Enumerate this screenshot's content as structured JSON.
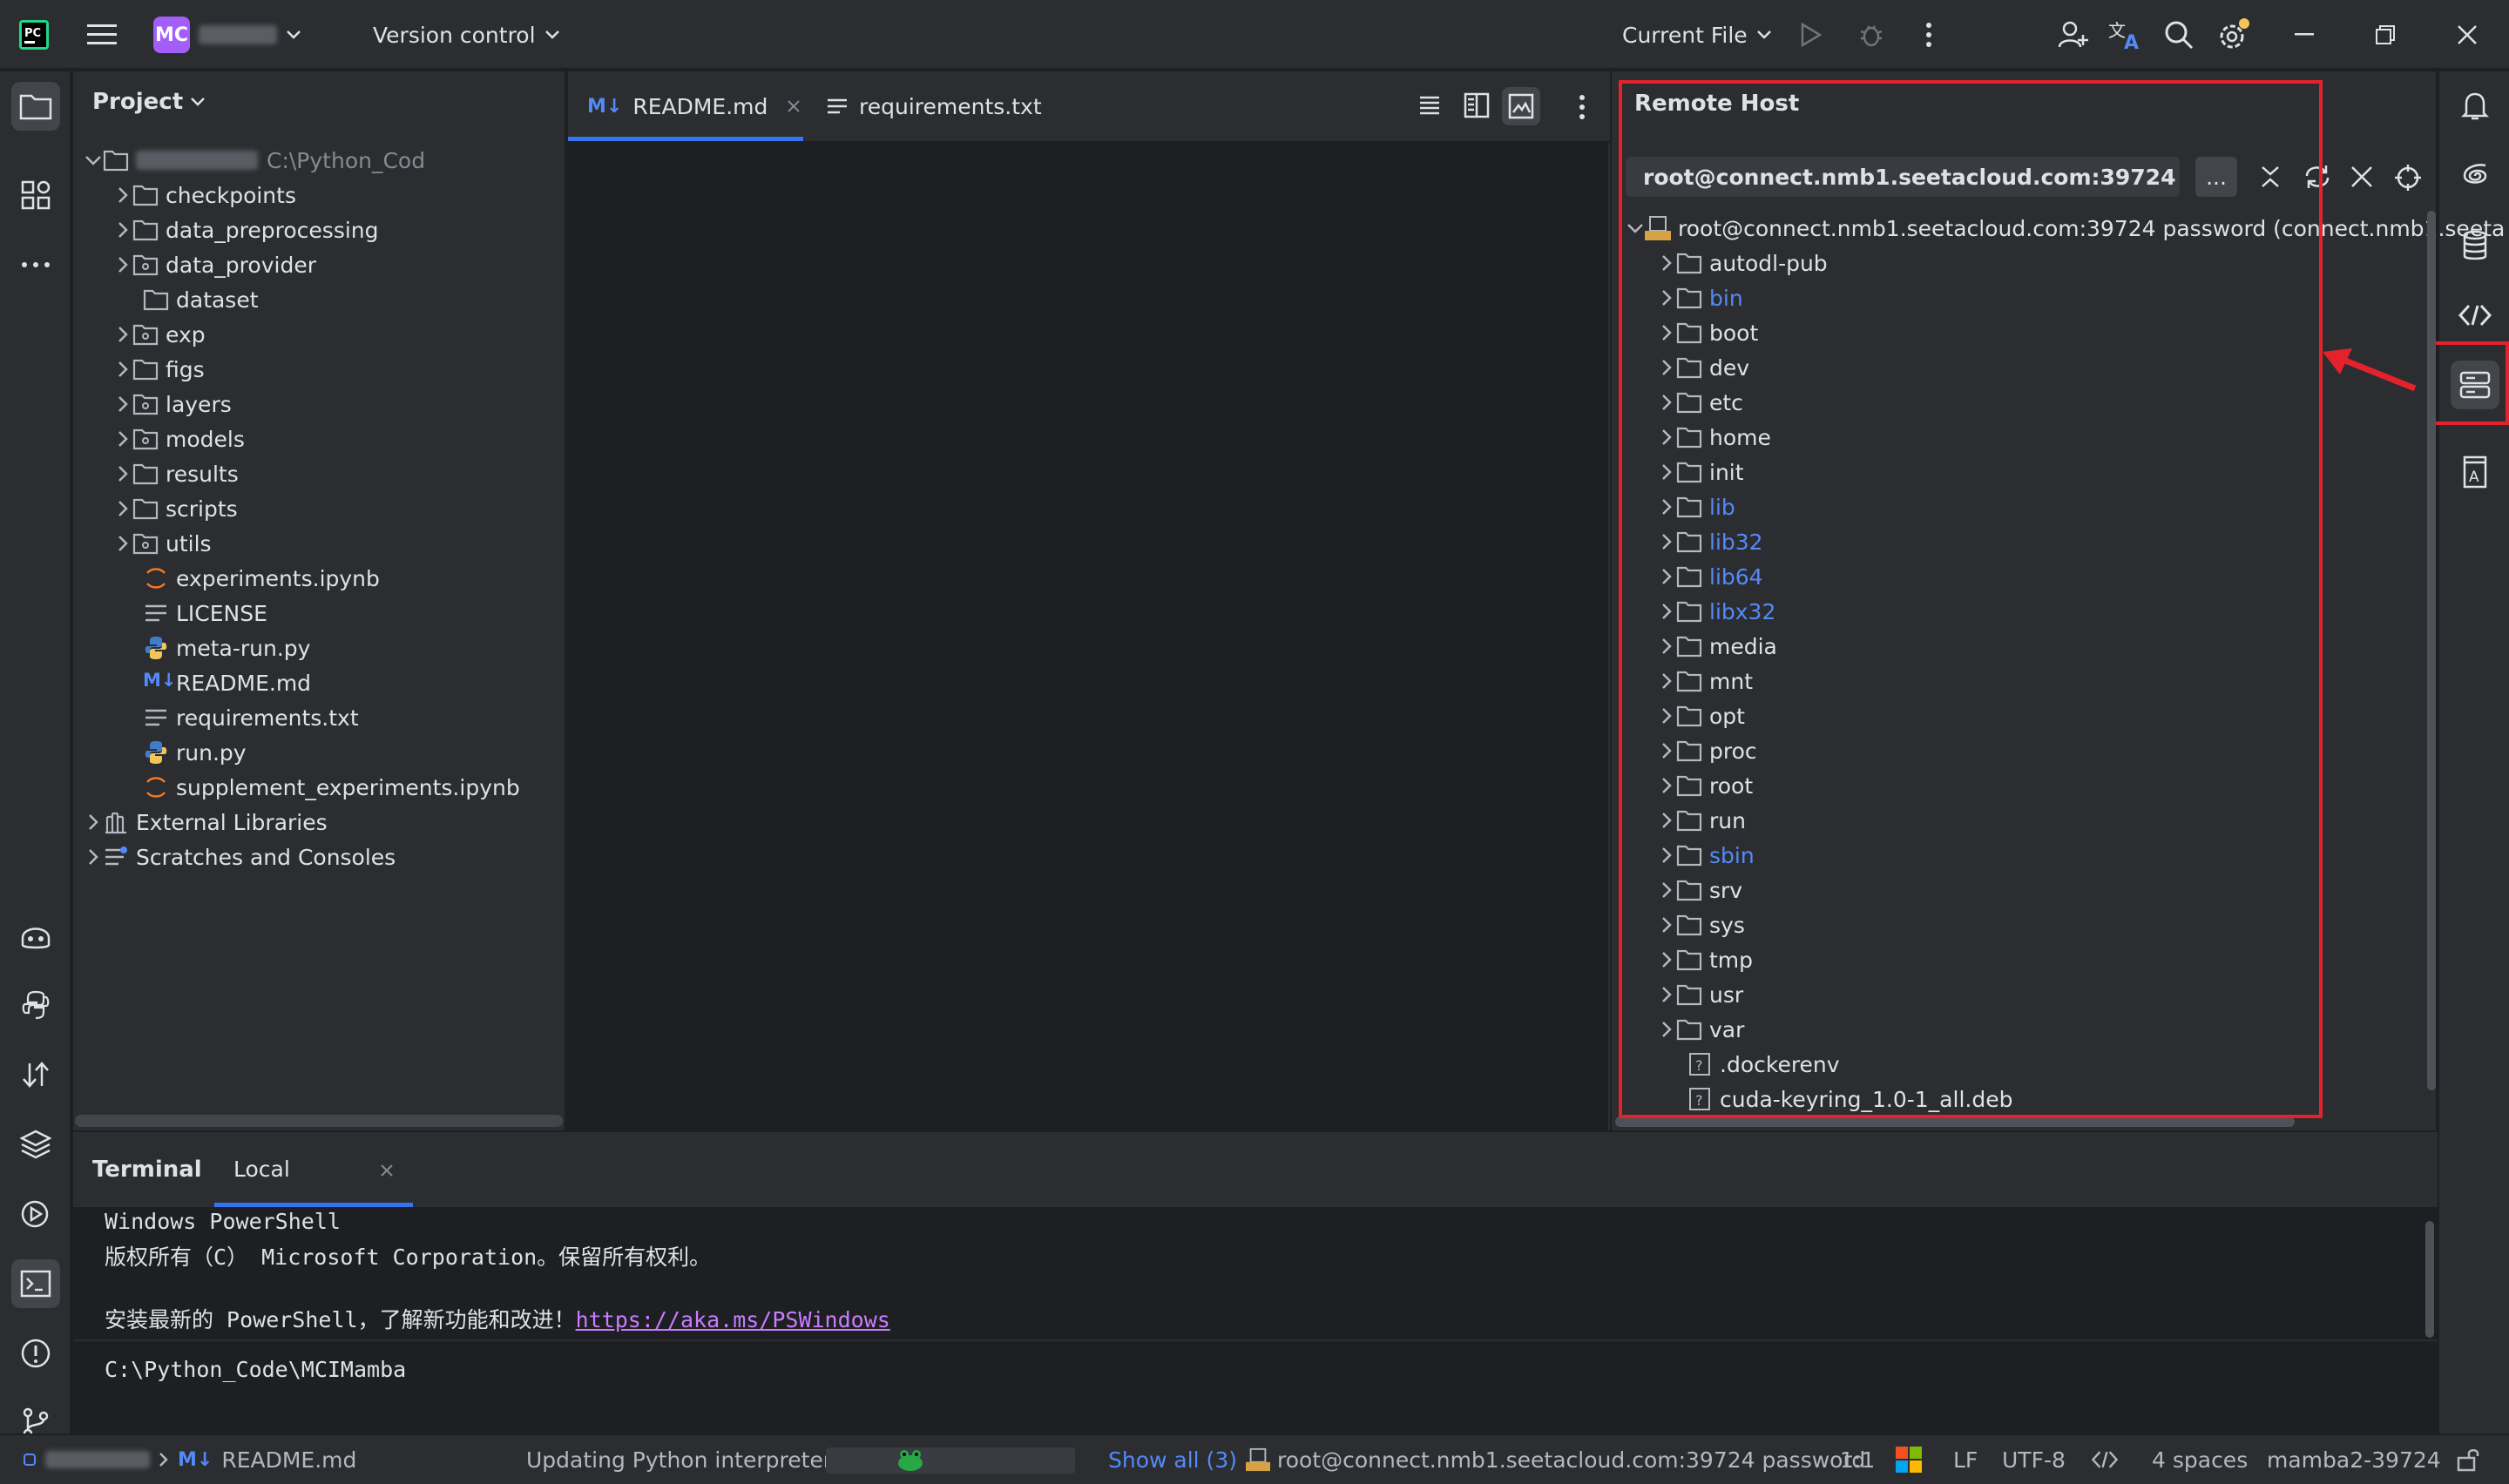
{
  "titlebar": {
    "project_badge": "MC",
    "version_control": "Version control",
    "run_config": "Current File"
  },
  "project_panel": {
    "title": "Project",
    "root_path": "C:\\Python_Cod",
    "items": [
      {
        "label": "checkpoints",
        "type": "folder"
      },
      {
        "label": "data_preprocessing",
        "type": "folder"
      },
      {
        "label": "data_provider",
        "type": "package"
      },
      {
        "label": "dataset",
        "type": "folder"
      },
      {
        "label": "exp",
        "type": "package"
      },
      {
        "label": "figs",
        "type": "folder"
      },
      {
        "label": "layers",
        "type": "package"
      },
      {
        "label": "models",
        "type": "package"
      },
      {
        "label": "results",
        "type": "folder"
      },
      {
        "label": "scripts",
        "type": "folder"
      },
      {
        "label": "utils",
        "type": "package"
      },
      {
        "label": "experiments.ipynb",
        "type": "notebook"
      },
      {
        "label": "LICENSE",
        "type": "text"
      },
      {
        "label": "meta-run.py",
        "type": "python"
      },
      {
        "label": "README.md",
        "type": "markdown"
      },
      {
        "label": "requirements.txt",
        "type": "text"
      },
      {
        "label": "run.py",
        "type": "python"
      },
      {
        "label": "supplement_experiments.ipynb",
        "type": "notebook"
      }
    ],
    "external_libraries": "External Libraries",
    "scratches": "Scratches and Consoles"
  },
  "editor_tabs": [
    {
      "label": "README.md",
      "active": true
    },
    {
      "label": "requirements.txt",
      "active": false
    }
  ],
  "remote_host": {
    "title": "Remote Host",
    "connection": "root@connect.nmb1.seetacloud.com:39724",
    "more_button": "...",
    "root_node": "root@connect.nmb1.seetacloud.com:39724 password (connect.nmb1.seeta",
    "items": [
      {
        "label": "autodl-pub",
        "blue": false
      },
      {
        "label": "bin",
        "blue": true
      },
      {
        "label": "boot",
        "blue": false
      },
      {
        "label": "dev",
        "blue": false
      },
      {
        "label": "etc",
        "blue": false
      },
      {
        "label": "home",
        "blue": false
      },
      {
        "label": "init",
        "blue": false
      },
      {
        "label": "lib",
        "blue": true
      },
      {
        "label": "lib32",
        "blue": true
      },
      {
        "label": "lib64",
        "blue": true
      },
      {
        "label": "libx32",
        "blue": true
      },
      {
        "label": "media",
        "blue": false
      },
      {
        "label": "mnt",
        "blue": false
      },
      {
        "label": "opt",
        "blue": false
      },
      {
        "label": "proc",
        "blue": false
      },
      {
        "label": "root",
        "blue": false
      },
      {
        "label": "run",
        "blue": false
      },
      {
        "label": "sbin",
        "blue": true
      },
      {
        "label": "srv",
        "blue": false
      },
      {
        "label": "sys",
        "blue": false
      },
      {
        "label": "tmp",
        "blue": false
      },
      {
        "label": "usr",
        "blue": false
      },
      {
        "label": "var",
        "blue": false
      }
    ],
    "files": [
      ".dockerenv",
      "cuda-keyring_1.0-1_all.deb"
    ]
  },
  "terminal": {
    "title": "Terminal",
    "tab": "Local",
    "line1": "Windows PowerShell",
    "line2": "版权所有（C） Microsoft Corporation。保留所有权利。",
    "line3_prefix": "安装最新的 PowerShell，了解新功能和改进！",
    "line3_link": "https://aka.ms/PSWindows",
    "prompt": "C:\\Python_Code\\MCIMamba"
  },
  "statusbar": {
    "file": "README.md",
    "task": "Updating Python interpreter",
    "show_all": "Show all (3)",
    "connection": "root@connect.nmb1.seetacloud.com:39724 password",
    "position": "1:1",
    "line_sep": "LF",
    "encoding": "UTF-8",
    "indent": "4 spaces",
    "interpreter": "mamba2-39724"
  }
}
